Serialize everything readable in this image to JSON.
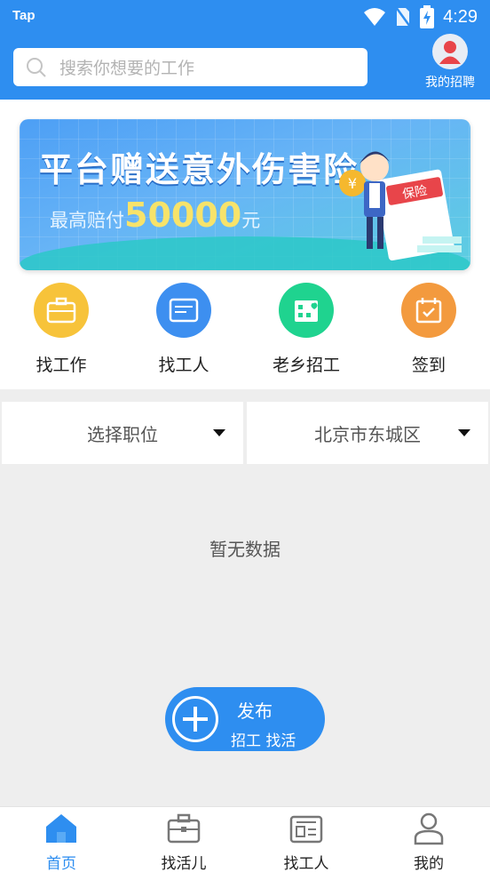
{
  "status_bar": {
    "app": "Tap",
    "time": "4:29"
  },
  "search": {
    "placeholder": "搜索你想要的工作"
  },
  "my_recruit": {
    "label": "我的招聘"
  },
  "banner": {
    "title": "平台赠送意外伤害险",
    "subtitle_prefix": "最高赔付",
    "amount": "50000",
    "unit": "元",
    "badge": "保险"
  },
  "quick_actions": [
    {
      "label": "找工作",
      "icon": "briefcase-icon",
      "color": "#f7c33a"
    },
    {
      "label": "找工人",
      "icon": "id-card-icon",
      "color": "#3d8ff0"
    },
    {
      "label": "老乡招工",
      "icon": "building-heart-icon",
      "color": "#1fd38f"
    },
    {
      "label": "签到",
      "icon": "calendar-check-icon",
      "color": "#f39a3e"
    }
  ],
  "filters": {
    "position": "选择职位",
    "location": "北京市东城区"
  },
  "empty_message": "暂无数据",
  "publish": {
    "title": "发布",
    "subtitle": "招工 找活"
  },
  "tabs": [
    {
      "label": "首页",
      "icon": "home-icon",
      "active": true
    },
    {
      "label": "找活儿",
      "icon": "briefcase-icon",
      "active": false
    },
    {
      "label": "找工人",
      "icon": "id-card-icon",
      "active": false
    },
    {
      "label": "我的",
      "icon": "person-icon",
      "active": false
    }
  ],
  "colors": {
    "primary": "#2e8ef0",
    "background": "#eeeeee"
  }
}
